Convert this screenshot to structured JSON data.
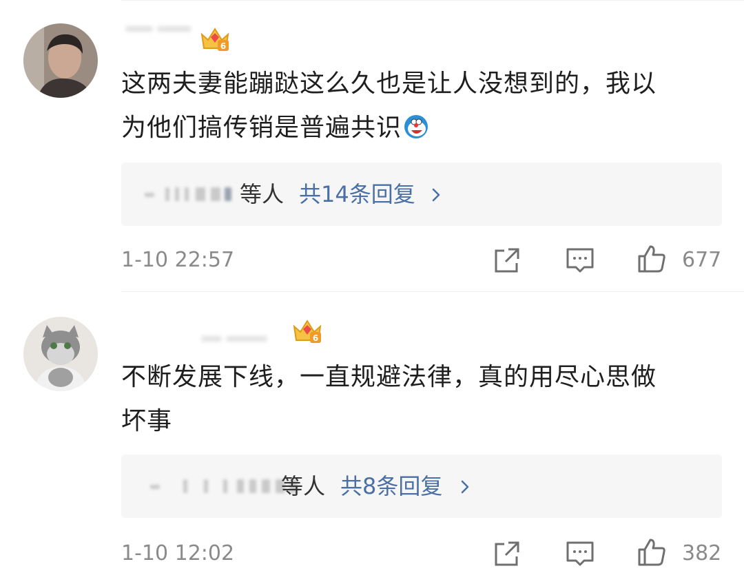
{
  "comments": [
    {
      "text_line1": "这两夫妻能蹦跶这么久也是让人没想到的，我以",
      "text_line2": "为他们搞传销是普遍共识",
      "emoji": "doraemon-emoji",
      "crown_level": "6",
      "reply_suffix": "等人",
      "reply_link": "共14条回复",
      "time": "1-10 22:57",
      "like_count": "677"
    },
    {
      "text_line1": "不断发展下线，一直规避法律，真的用尽心思做",
      "text_line2": "坏事",
      "crown_level": "6",
      "reply_suffix": "等人",
      "reply_link": "共8条回复",
      "time": "1-10 12:02",
      "like_count": "382"
    }
  ],
  "icons": {
    "share": "share-icon",
    "comment": "comment-icon",
    "like": "like-icon",
    "crown": "crown-badge-icon",
    "chevron": "chevron-right-icon"
  },
  "colors": {
    "link": "#4a6fa5",
    "meta": "#8a8a8a",
    "reply_bg": "#f6f6f6"
  }
}
